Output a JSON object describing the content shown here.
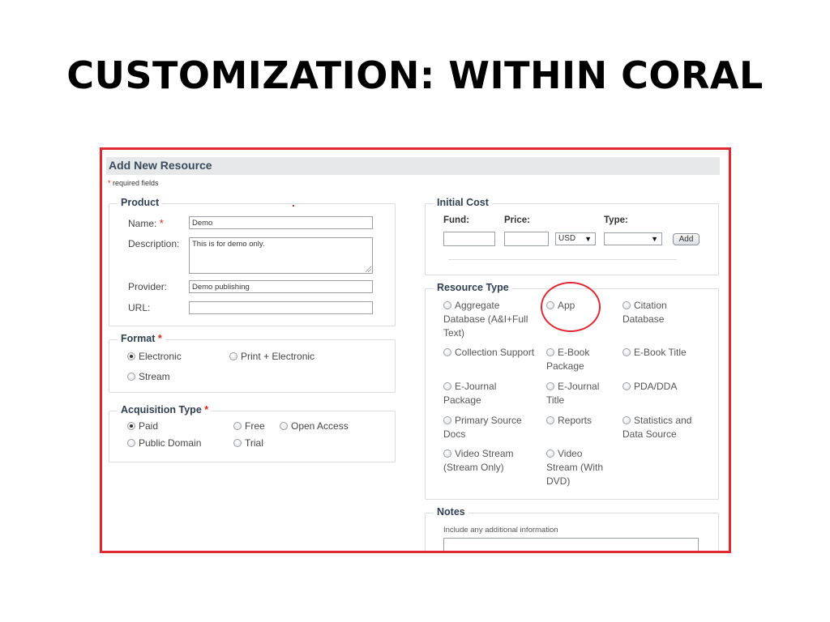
{
  "slide": {
    "title": "CUSTOMIZATION: WITHIN CORAL"
  },
  "form": {
    "title": "Add New Resource",
    "required_note_star": "*",
    "required_note": " required fields"
  },
  "product": {
    "legend": "Product",
    "name_label": "Name:",
    "name_required": "*",
    "name_value": "Demo",
    "description_label": "Description:",
    "description_value": "This is for demo only.",
    "provider_label": "Provider:",
    "provider_value": "Demo publishing",
    "url_label": "URL:",
    "url_value": ""
  },
  "format": {
    "legend": "Format",
    "required": "*",
    "options": [
      {
        "label": "Electronic",
        "checked": true
      },
      {
        "label": "Print + Electronic",
        "checked": false
      },
      {
        "label": "Stream",
        "checked": false
      }
    ]
  },
  "acquisition": {
    "legend": "Acquisition Type",
    "required": "*",
    "options": [
      {
        "label": "Paid",
        "checked": true
      },
      {
        "label": "Free",
        "checked": false
      },
      {
        "label": "Open Access",
        "checked": false
      },
      {
        "label": "Public Domain",
        "checked": false
      },
      {
        "label": "Trial",
        "checked": false
      }
    ]
  },
  "initial_cost": {
    "legend": "Initial Cost",
    "fund_label": "Fund:",
    "price_label": "Price:",
    "type_label": "Type:",
    "currency_value": "USD",
    "type_value": "",
    "add_label": "Add"
  },
  "resource_type": {
    "legend": "Resource Type",
    "options": [
      {
        "label": "Aggregate Database (A&I+Full Text)"
      },
      {
        "label": "App"
      },
      {
        "label": "Citation Database"
      },
      {
        "label": "Collection Support"
      },
      {
        "label": "E-Book Package"
      },
      {
        "label": "E-Book Title"
      },
      {
        "label": "E-Journal Package"
      },
      {
        "label": "E-Journal Title"
      },
      {
        "label": "PDA/DDA"
      },
      {
        "label": "Primary Source Docs"
      },
      {
        "label": "Reports"
      },
      {
        "label": "Statistics and Data Source"
      },
      {
        "label": "Video Stream (Stream Only)"
      },
      {
        "label": "Video Stream (With DVD)"
      }
    ]
  },
  "notes": {
    "legend": "Notes",
    "hint": "Include any additional information",
    "value": ""
  },
  "colors": {
    "annotation_red": "#e02a33",
    "header_bg": "#e6e8ea",
    "legend_text": "#2f3f52"
  }
}
